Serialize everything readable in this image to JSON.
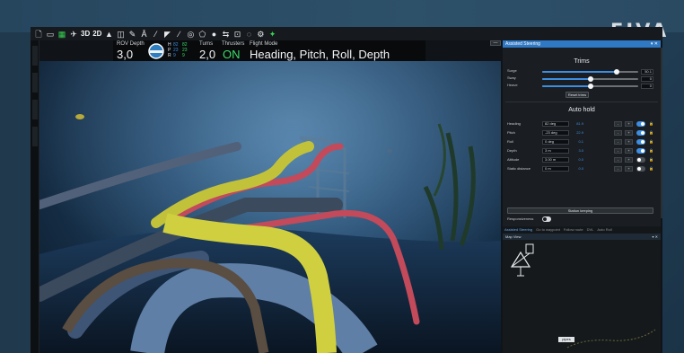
{
  "brand": "EIVA",
  "toolbar": {
    "icons": [
      "file-icon",
      "folder-icon",
      "save-icon",
      "satellite-icon"
    ],
    "view_3d": "3D",
    "view_2d": "2D",
    "icons2": [
      "arrow-up-icon",
      "book-icon",
      "pencil-icon",
      "text-icon",
      "line-icon",
      "arrow-icon",
      "curve-icon",
      "target-icon",
      "pentagon-icon",
      "sphere-icon",
      "steering-icon",
      "camera-icon",
      "box-icon",
      "gear-icon",
      "gamepad-icon"
    ]
  },
  "hud": {
    "rov_depth_label": "ROV Depth",
    "rov_depth_value": "3,0",
    "indicators": [
      {
        "l": "H",
        "a": "82",
        "b": "82"
      },
      {
        "l": "P",
        "a": "23",
        "b": "23"
      },
      {
        "l": "R",
        "a": "9",
        "b": "9"
      }
    ],
    "turns_label": "Turns",
    "turns_value": "2,0",
    "thrusters_label": "Thrusters",
    "thrusters_value": "ON",
    "flight_mode_label": "Flight Mode",
    "flight_mode_value": "Heading, Pitch, Roll, Depth"
  },
  "panel": {
    "title": "Assisted Steering",
    "title_controls": "▾ ✕",
    "trims_title": "Trims",
    "trims": [
      {
        "label": "Surge",
        "value": "50.1",
        "level": 0.78
      },
      {
        "label": "Sway",
        "value": "0",
        "level": 0.5
      },
      {
        "label": "Heave",
        "value": "0",
        "level": 0.5
      }
    ],
    "reset_label": "Reset trims",
    "autohold_title": "Auto hold",
    "autohold": [
      {
        "label": "Heading",
        "input": "82 deg",
        "num": "81.9",
        "minus": "-",
        "plus": "+",
        "on": true
      },
      {
        "label": "Pitch",
        "input": "-23 deg",
        "num": "22.9",
        "minus": "-",
        "plus": "+",
        "on": true
      },
      {
        "label": "Roll",
        "input": "0 deg",
        "num": "0.1",
        "minus": "-",
        "plus": "+",
        "on": true
      },
      {
        "label": "Depth",
        "input": "3 m",
        "num": "3.0",
        "minus": "-",
        "plus": "+",
        "on": true
      },
      {
        "label": "Altitude",
        "input": "3.00 m",
        "num": "0.0",
        "minus": "-",
        "plus": "+",
        "on": false
      },
      {
        "label": "Static distance",
        "input": "0 m",
        "num": "0.0",
        "minus": "-",
        "plus": "+",
        "on": false
      }
    ],
    "lock_glyph": "🔒",
    "station_keeping_label": "Station keeping",
    "responsiveness_label": "Responsiveness",
    "tabs": [
      "Assisted Steering",
      "Go to waypoint",
      "Follow route",
      "DVL",
      "Auto Roll"
    ],
    "map_title": "Map View",
    "map_controls": "▾ ✕",
    "map_label": "pipes"
  },
  "minimize_glyph": "—"
}
